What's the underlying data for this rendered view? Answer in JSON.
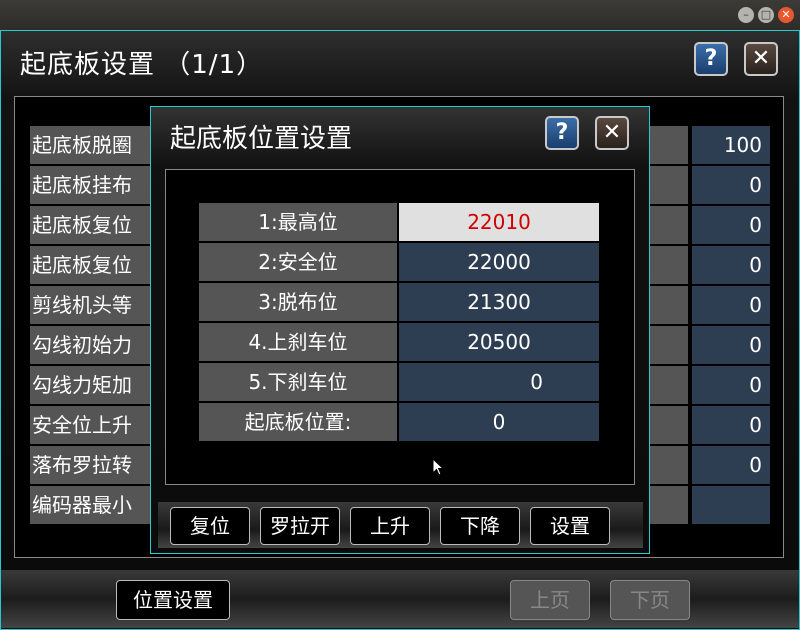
{
  "main": {
    "title": "起底板设置 （1/1）",
    "rows": [
      {
        "label": "起底板脱圈",
        "value": "100"
      },
      {
        "label": "起底板挂布",
        "value": "0"
      },
      {
        "label": "起底板复位",
        "value": "0"
      },
      {
        "label": "起底板复位",
        "value": "0"
      },
      {
        "label": "剪线机头等",
        "value": "0"
      },
      {
        "label": "勾线初始力",
        "value": "0"
      },
      {
        "label": "勾线力矩加",
        "value": "0"
      },
      {
        "label": "安全位上升",
        "value": "0"
      },
      {
        "label": "落布罗拉转",
        "value": "0"
      },
      {
        "label": "编码器最小",
        "value": ""
      }
    ]
  },
  "bottom": {
    "position_setting": "位置设置",
    "prev_page": "上页",
    "next_page": "下页"
  },
  "dialog": {
    "title": "起底板位置设置",
    "positions": [
      {
        "label": "1:最高位",
        "value": "22010"
      },
      {
        "label": "2:安全位",
        "value": "22000"
      },
      {
        "label": "3:脱布位",
        "value": "21300"
      },
      {
        "label": "4.上刹车位",
        "value": "20500"
      },
      {
        "label": "5.下刹车位",
        "value": "0"
      },
      {
        "label": "起底板位置:",
        "value": "0"
      }
    ],
    "buttons": [
      "复位",
      "罗拉开",
      "上升",
      "下降",
      "设置"
    ]
  },
  "icons": {
    "help": "?",
    "close": "✕"
  },
  "colors": {
    "accent_border": "#28c8d0",
    "selected_value": "#d00000"
  }
}
